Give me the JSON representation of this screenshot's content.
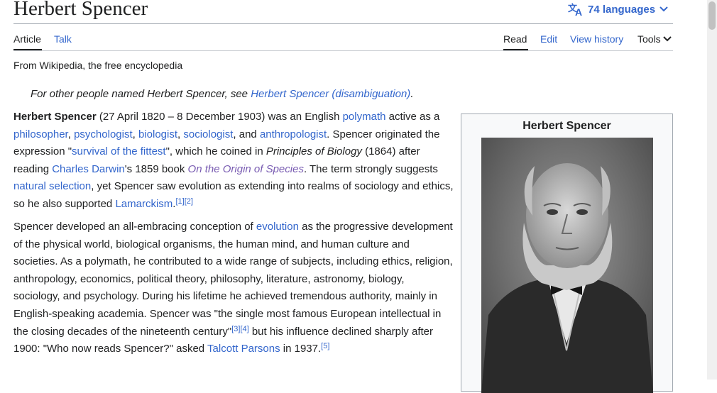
{
  "page": {
    "title": "Herbert Spencer",
    "languages_label": "74 languages",
    "tagline": "From Wikipedia, the free encyclopedia"
  },
  "tabs": {
    "article": "Article",
    "talk": "Talk",
    "read": "Read",
    "edit": "Edit",
    "view_history": "View history",
    "tools": "Tools"
  },
  "hatnote": {
    "prefix": "For other people named Herbert Spencer, see ",
    "link": "Herbert Spencer (disambiguation)",
    "suffix": "."
  },
  "para1": {
    "subject": "Herbert Spencer",
    "t1": " (27 April 1820 – 8 December 1903) was an English ",
    "l_polymath": "polymath",
    "t2": " active as a ",
    "l_philosopher": "philosopher",
    "t3": ", ",
    "l_psychologist": "psychologist",
    "t4": ", ",
    "l_biologist": "biologist",
    "t5": ", ",
    "l_sociologist": "sociologist",
    "t6": ", and ",
    "l_anthropologist": "anthropologist",
    "t7": ". Spencer originated the expression \"",
    "l_survival": "survival of the fittest",
    "t8": "\", which he coined in ",
    "i_principles": "Principles of Biology",
    "t9": " (1864) after reading ",
    "l_darwin": "Charles Darwin",
    "t10": "'s 1859 book ",
    "l_origin": "On the Origin of Species",
    "t11": ". The term strongly suggests ",
    "l_natural": "natural selection",
    "t12": ", yet Spencer saw evolution as extending into realms of sociology and ethics, so he also supported ",
    "l_lamarckism": "Lamarckism",
    "t13": ".",
    "ref1": "[1]",
    "ref2": "[2]"
  },
  "para2": {
    "t1": "Spencer developed an all-embracing conception of ",
    "l_evolution": "evolution",
    "t2": " as the progressive development of the physical world, biological organisms, the human mind, and human culture and societies. As a polymath, he contributed to a wide range of subjects, including ethics, religion, anthropology, economics, political theory, philosophy, literature, astronomy, biology, sociology, and psychology. During his lifetime he achieved tremendous authority, mainly in English-speaking academia. Spencer was \"the single most famous European intellectual in the closing decades of the nineteenth century\"",
    "ref3": "[3]",
    "ref4": "[4]",
    "t3": " but his influence declined sharply after 1900: \"Who now reads Spencer?\" asked ",
    "l_parsons": "Talcott Parsons",
    "t4": " in 1937.",
    "ref5": "[5]"
  },
  "infobox": {
    "title": "Herbert Spencer"
  },
  "icons": {
    "language": "translate-icon",
    "chevron": "chevron-down-icon"
  },
  "colors": {
    "link": "#3366cc",
    "visited_link": "#795cb2",
    "text": "#202122",
    "infobox_bg": "#f8f9fa"
  }
}
